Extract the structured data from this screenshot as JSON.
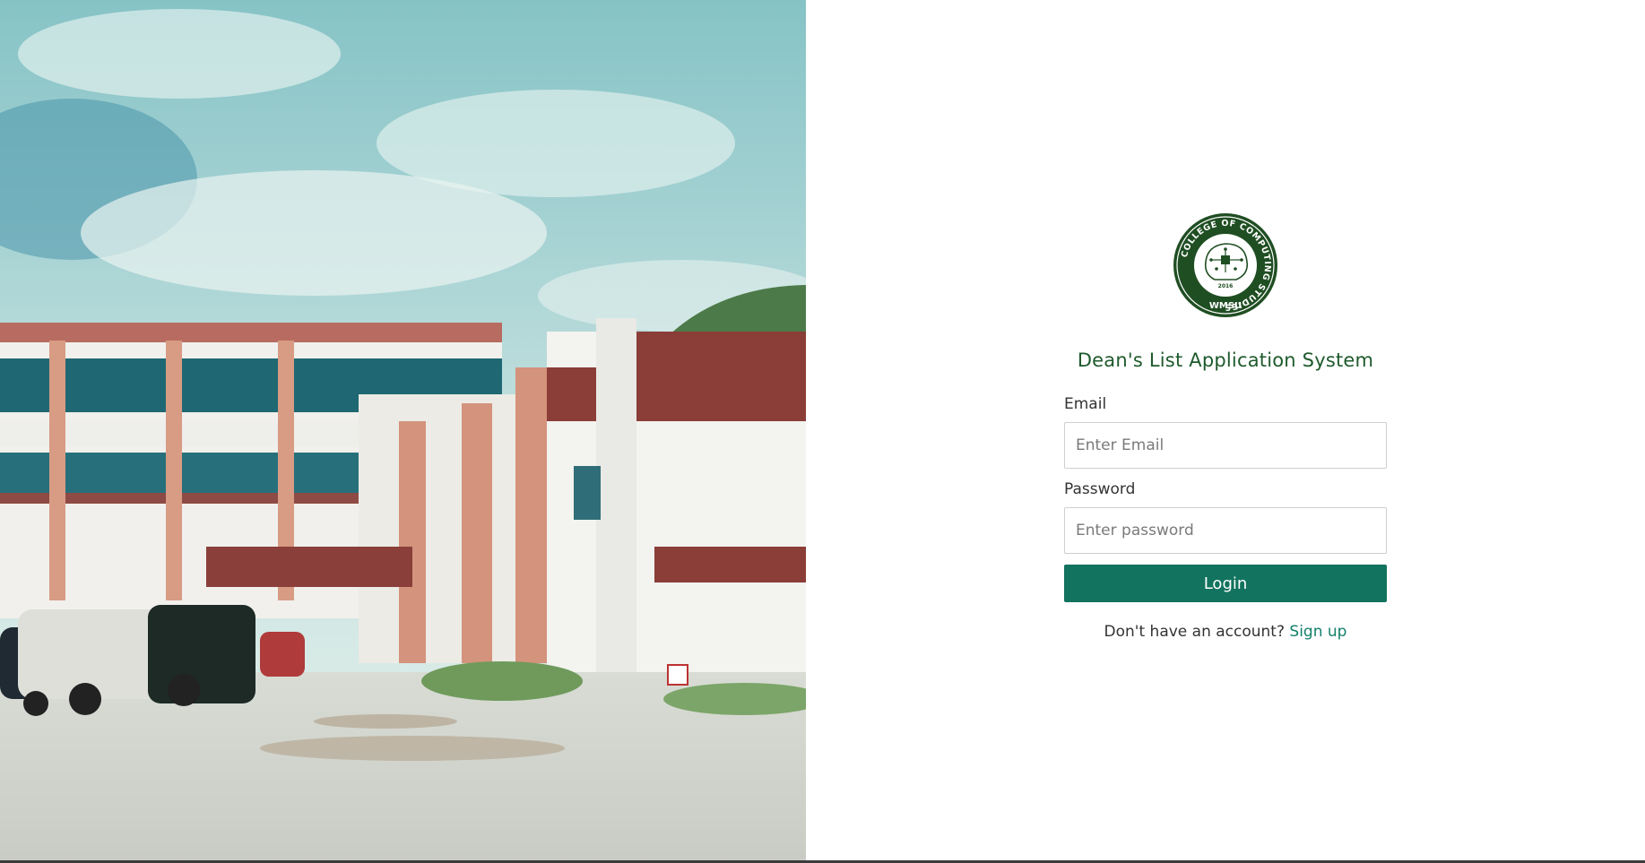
{
  "login": {
    "logo": {
      "ring_text": "COLLEGE OF COMPUTING STUDIES",
      "year": "2016",
      "acronym": "WMSU",
      "colors": {
        "ring": "#1f4e22",
        "inner": "#ffffff"
      }
    },
    "title": "Dean's List Application System",
    "email": {
      "label": "Email",
      "placeholder": "Enter Email"
    },
    "password": {
      "label": "Password",
      "placeholder": "Enter password"
    },
    "login_button": "Login",
    "signup_prompt": "Don't have an account?",
    "signup_link": "Sign up"
  },
  "colors": {
    "primary": "#12735e",
    "title": "#1e5a2c",
    "link": "#13806a"
  }
}
